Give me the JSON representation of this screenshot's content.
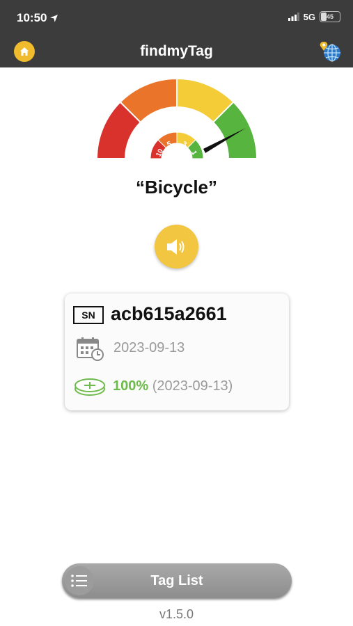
{
  "status_bar": {
    "time": "10:50",
    "network": "5G",
    "battery": "45"
  },
  "header": {
    "title": "findmyTag"
  },
  "gauge": {
    "labels": [
      "10",
      "5",
      "3",
      "1"
    ]
  },
  "tag": {
    "name": "“Bicycle”",
    "sn_label": "SN",
    "serial": "acb615a2661",
    "date": "2023-09-13",
    "battery_percent": "100%",
    "battery_date": "(2023-09-13)"
  },
  "footer": {
    "tag_list_label": "Tag List",
    "version": "v1.5.0"
  },
  "colors": {
    "accent": "#f2c641",
    "header_bg": "#3c3c3c",
    "gauge_red": "#d9312b",
    "gauge_orange": "#e9742a",
    "gauge_yellow": "#f3cc38",
    "gauge_green": "#56b43f",
    "battery_green": "#6dbb4a"
  }
}
